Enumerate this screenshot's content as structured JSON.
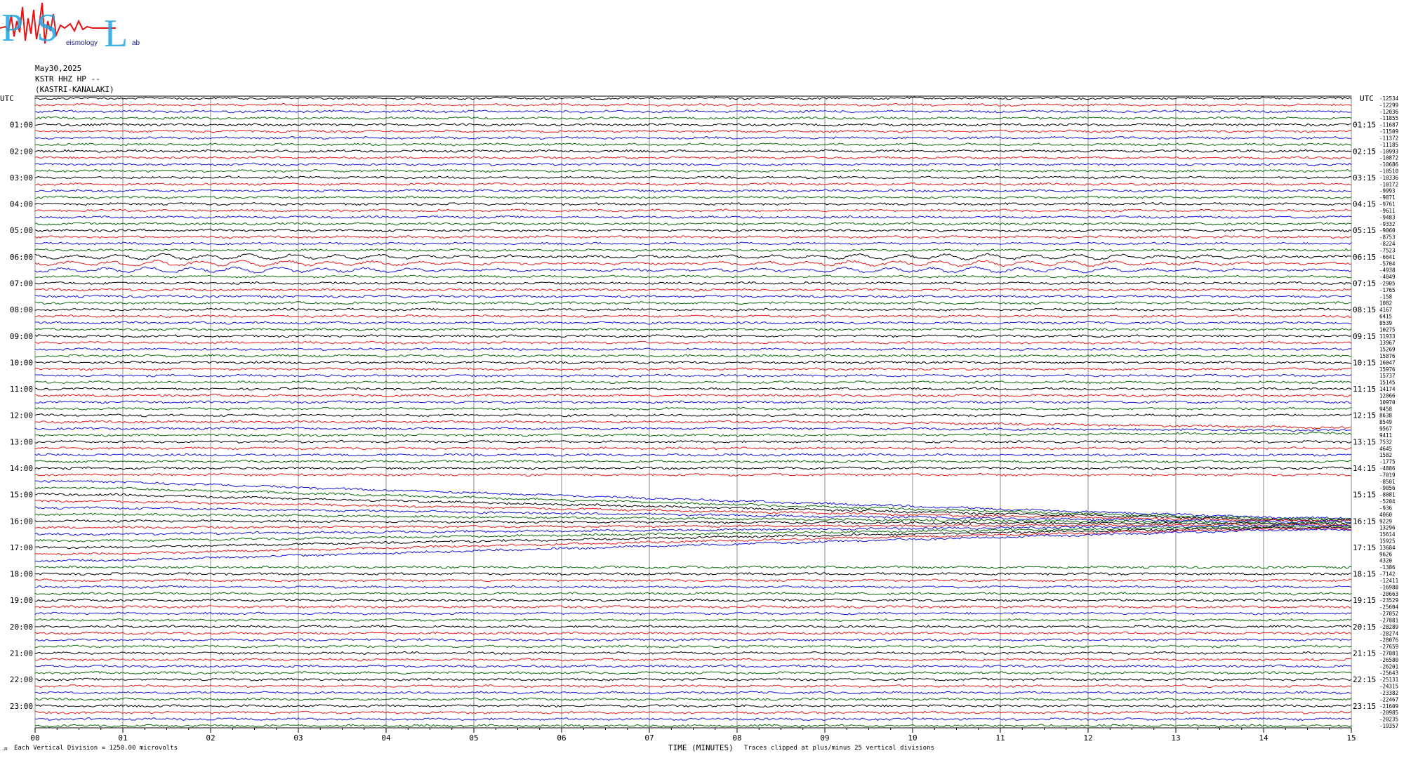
{
  "logo": {
    "letters": [
      "P",
      "S",
      "L"
    ],
    "subtitle_parts": [
      "eismology",
      "ab"
    ]
  },
  "header": {
    "date": "May30,2025",
    "channel": "KSTR HHZ HP --",
    "station": "(KASTRI-KANALAKI)"
  },
  "colors": {
    "trace_cycle": [
      "#000000",
      "#e8191a",
      "#1515e0",
      "#0a6b0a"
    ],
    "gridline": "#8c8c8c",
    "logo_red": "#e81212",
    "logo_blue": "#1ea5e0"
  },
  "footer": {
    "vertical_division": "Each Vertical Division = 1250.00 microvolts",
    "xaxis_title": "TIME (MINUTES)",
    "clip_note": "Traces clipped at plus/minus 25 vertical divisions"
  },
  "chart_data": {
    "type": "line",
    "title": "KSTR HHZ HP -- (KASTRI-KANALAKI) May30,2025",
    "xlabel": "TIME (MINUTES)",
    "xlim": [
      0,
      15
    ],
    "x_ticks": [
      "00",
      "01",
      "02",
      "03",
      "04",
      "05",
      "06",
      "07",
      "08",
      "09",
      "10",
      "11",
      "12",
      "13",
      "14",
      "15"
    ],
    "grid": true,
    "left_axis_unit": "UTC",
    "right_axis_unit": "UTC",
    "left_hour_labels": [
      "01:00",
      "02:00",
      "03:00",
      "04:00",
      "05:00",
      "06:00",
      "07:00",
      "08:00",
      "09:00",
      "10:00",
      "11:00",
      "12:00",
      "13:00",
      "14:00",
      "15:00",
      "16:00",
      "17:00",
      "18:00",
      "19:00",
      "20:00",
      "21:00",
      "22:00",
      "23:00"
    ],
    "right_hour_labels": [
      "01:15",
      "02:15",
      "03:15",
      "04:15",
      "05:15",
      "06:15",
      "07:15",
      "08:15",
      "09:15",
      "10:15",
      "11:15",
      "12:15",
      "13:15",
      "14:15",
      "15:15",
      "16:15",
      "17:15",
      "18:15",
      "19:15",
      "20:15",
      "21:15",
      "22:15",
      "23:15"
    ],
    "trace_count": 96,
    "trace_minutes": 15,
    "right_values": [
      -12534,
      -12299,
      -12036,
      -11855,
      -11687,
      -11509,
      -11372,
      -11185,
      -10993,
      -10872,
      -10686,
      -10510,
      -10336,
      -10172,
      -9993,
      -9871,
      -9761,
      -9611,
      -9483,
      -9332,
      -9060,
      -8753,
      -8224,
      -7523,
      -6641,
      -5704,
      -4938,
      -4049,
      -2905,
      -1765,
      -158,
      1082,
      4167,
      6415,
      8539,
      10275,
      11933,
      13967,
      15269,
      15876,
      16047,
      15976,
      15737,
      15145,
      14174,
      12066,
      10970,
      9458,
      8638,
      8549,
      9567,
      9411,
      7532,
      4645,
      1582,
      -1775,
      -4886,
      -7019,
      -8501,
      -9056,
      -8081,
      -5204,
      -936,
      4060,
      9229,
      13296,
      15614,
      15925,
      13684,
      9626,
      4320,
      -1386,
      -7142,
      -12411,
      -16988,
      -20663,
      -23529,
      -25604,
      -27052,
      -27881,
      -28289,
      -28274,
      -28076,
      -27659,
      -27081,
      -26580,
      -26201,
      -25643,
      -25131,
      -24315,
      -23382,
      -22467,
      -21609,
      -20985,
      -20235,
      -19357
    ],
    "events": [
      {
        "trace_start": 24,
        "trace_end": 26,
        "description": "long-period oscillation"
      },
      {
        "trace_start": 49,
        "trace_end": 51,
        "description": "converging traces"
      },
      {
        "trace_start": 60,
        "trace_end": 70,
        "description": "converging traces"
      }
    ]
  }
}
